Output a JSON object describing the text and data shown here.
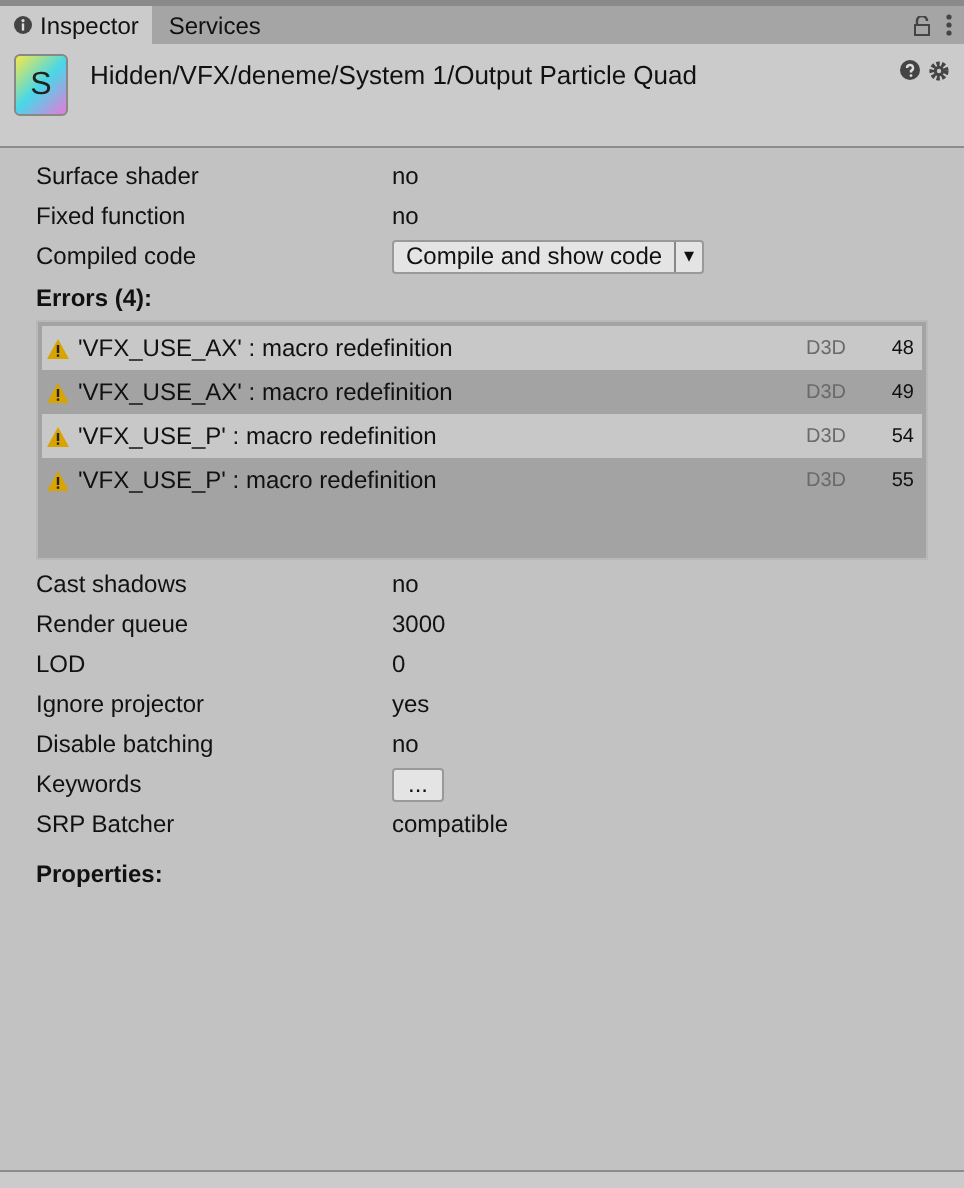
{
  "tabs": [
    {
      "label": "Inspector",
      "selected": true,
      "kind": "info"
    },
    {
      "label": "Services",
      "selected": false,
      "kind": "plain"
    }
  ],
  "header": {
    "title": "Hidden/VFX/deneme/System 1/Output Particle Quad",
    "icon_letter": "S"
  },
  "properties_top": [
    {
      "label": "Surface shader",
      "value": "no",
      "kind": "text"
    },
    {
      "label": "Fixed function",
      "value": "no",
      "kind": "text"
    },
    {
      "label": "Compiled code",
      "value": "Compile and show code",
      "arrow": "▾",
      "kind": "dropdown"
    }
  ],
  "errors": {
    "heading": "Errors (4):",
    "rows": [
      {
        "message": "'VFX_USE_AX' : macro redefinition",
        "platform": "D3D",
        "line": "48"
      },
      {
        "message": "'VFX_USE_AX' : macro redefinition",
        "platform": "D3D",
        "line": "49"
      },
      {
        "message": "'VFX_USE_P' : macro redefinition",
        "platform": "D3D",
        "line": "54"
      },
      {
        "message": "'VFX_USE_P' : macro redefinition",
        "platform": "D3D",
        "line": "55"
      }
    ]
  },
  "properties_bottom": [
    {
      "label": "Cast shadows",
      "value": "no",
      "kind": "text"
    },
    {
      "label": "Render queue",
      "value": "3000",
      "kind": "text"
    },
    {
      "label": "LOD",
      "value": "0",
      "kind": "text"
    },
    {
      "label": "Ignore projector",
      "value": "yes",
      "kind": "text"
    },
    {
      "label": "Disable batching",
      "value": "no",
      "kind": "text"
    },
    {
      "label": "Keywords",
      "value": "...",
      "kind": "button"
    },
    {
      "label": "SRP Batcher",
      "value": "compatible",
      "kind": "text"
    }
  ],
  "properties_heading": "Properties:"
}
